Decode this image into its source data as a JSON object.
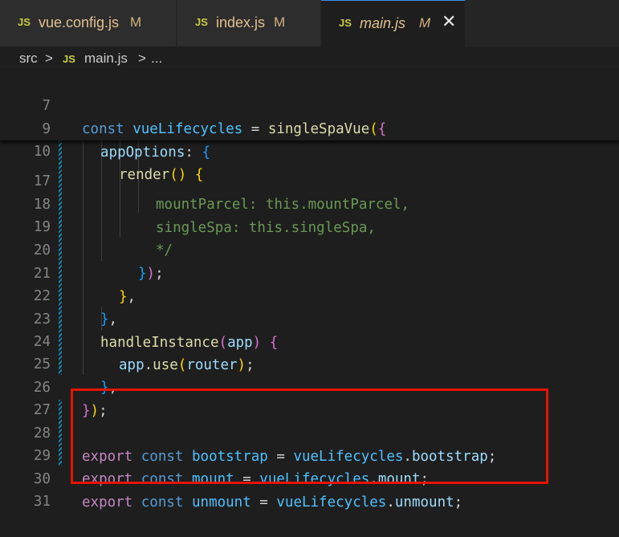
{
  "tabs": [
    {
      "icon": "JS",
      "name": "vue.config.js",
      "status": "M",
      "active": false
    },
    {
      "icon": "JS",
      "name": "index.js",
      "status": "M",
      "active": false
    },
    {
      "icon": "JS",
      "name": "main.js",
      "status": "M",
      "active": true
    }
  ],
  "close_glyph": "✕",
  "breadcrumb": {
    "folder": "src",
    "sep": ">",
    "icon": "JS",
    "file": "main.js",
    "more": "..."
  },
  "sticky_lines": [
    {
      "num": "7",
      "text": "const vueLifecycles = singleSpaVue({"
    },
    {
      "num": "9",
      "text": "appOptions: {"
    },
    {
      "num": "10",
      "text": "render() {"
    }
  ],
  "lines": [
    {
      "num": "17",
      "text": "mountParcel: this.mountParcel,"
    },
    {
      "num": "18",
      "text": "singleSpa: this.singleSpa,"
    },
    {
      "num": "19",
      "text": "*/"
    },
    {
      "num": "20",
      "text": "});"
    },
    {
      "num": "21",
      "text": "},"
    },
    {
      "num": "22",
      "text": "},"
    },
    {
      "num": "23",
      "text": "handleInstance(app) {"
    },
    {
      "num": "24",
      "text": "app.use(router);"
    },
    {
      "num": "25",
      "text": "},"
    },
    {
      "num": "26",
      "text": "});"
    },
    {
      "num": "27",
      "text": ""
    },
    {
      "num": "28",
      "text": "export const bootstrap = vueLifecycles.bootstrap;"
    },
    {
      "num": "29",
      "text": "export const mount = vueLifecycles.mount;"
    },
    {
      "num": "30",
      "text": "export const unmount = vueLifecycles.unmount;"
    },
    {
      "num": "31",
      "text": ""
    }
  ],
  "colors": {
    "highlight_box": "#e51400",
    "accent": "#3b8eea",
    "modified": "#e2c08d",
    "js_icon": "#cbcb41"
  }
}
